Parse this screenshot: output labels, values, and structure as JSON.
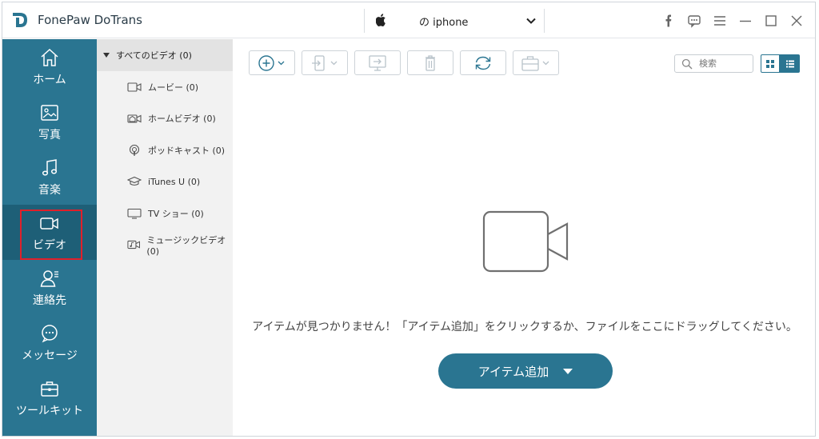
{
  "app": {
    "title": "FonePaw DoTrans"
  },
  "device": {
    "name": "の iphone"
  },
  "nav": {
    "items": [
      {
        "label": "ホーム",
        "icon": "home-icon"
      },
      {
        "label": "写真",
        "icon": "photo-icon"
      },
      {
        "label": "音楽",
        "icon": "music-icon"
      },
      {
        "label": "ビデオ",
        "icon": "video-icon",
        "active": true
      },
      {
        "label": "連絡先",
        "icon": "contacts-icon"
      },
      {
        "label": "メッセージ",
        "icon": "message-icon"
      },
      {
        "label": "ツールキット",
        "icon": "toolkit-icon"
      }
    ]
  },
  "categories": {
    "header": "すべてのビデオ (0)",
    "items": [
      {
        "label": "ムービー (0)",
        "icon": "movie-icon"
      },
      {
        "label": "ホームビデオ (0)",
        "icon": "home-video-icon"
      },
      {
        "label": "ポッドキャスト (0)",
        "icon": "podcast-icon"
      },
      {
        "label": "iTunes U (0)",
        "icon": "itunes-u-icon"
      },
      {
        "label": "TV ショー (0)",
        "icon": "tv-icon"
      },
      {
        "label": "ミュージックビデオ (0)",
        "icon": "music-video-icon"
      }
    ]
  },
  "search": {
    "placeholder": "検索"
  },
  "empty": {
    "message": "アイテムが見つかりません！「アイテム追加」をクリックするか、ファイルをここにドラッグしてください。",
    "add_button": "アイテム追加"
  },
  "colors": {
    "accent": "#2a7591",
    "nav_active": "#1e5f77",
    "highlight": "#e0202a"
  }
}
